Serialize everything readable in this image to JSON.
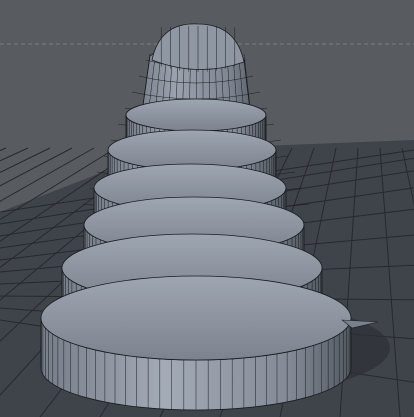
{
  "viewport": {
    "view": "perspective",
    "background_color": "#585b60",
    "ground_color": "#3f444a",
    "grid_line_color": "#262a2f",
    "mesh_fill_color": "#8c93a0",
    "mesh_shadow_color": "#4a5058",
    "wire_color": "#1a1c20"
  },
  "scene": {
    "object": "spiral-cone-mesh",
    "display": "gouraud-shading-with-lines"
  }
}
